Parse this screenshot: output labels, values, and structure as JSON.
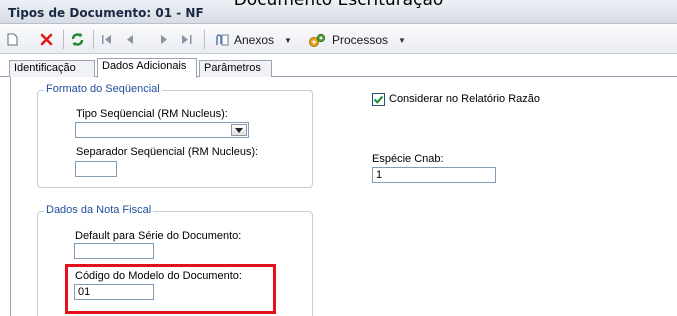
{
  "caption": "Documento Escrituração",
  "window": {
    "title": "Tipos de Documento: 01 - NF"
  },
  "toolbar": {
    "anexos_label": "Anexos",
    "processos_label": "Processos",
    "dropdown_arrow": "▼"
  },
  "tabs": [
    {
      "label": "Identificação",
      "active": false
    },
    {
      "label": "Dados Adicionais",
      "active": true
    },
    {
      "label": "Parâmetros",
      "active": false
    }
  ],
  "formato_sequencial": {
    "legend": "Formato do Seqüencial",
    "tipo_label": "Tipo Seqüencial (RM Nucleus):",
    "tipo_value": "",
    "separador_label": "Separador Seqüencial (RM Nucleus):",
    "separador_value": ""
  },
  "considerar_razao": {
    "label": "Considerar no Relatório Razão",
    "checked": true
  },
  "especie_cnab": {
    "label": "Espécie Cnab:",
    "value": "1"
  },
  "dados_nota_fiscal": {
    "legend": "Dados da Nota Fiscal",
    "serie_label": "Default para Série do Documento:",
    "serie_value": "",
    "modelo_label": "Código do Modelo do Documento:",
    "modelo_value": "01"
  },
  "colors": {
    "highlight": "#e3111b",
    "legend_text": "#1f4e9c",
    "check": "#1a8a2e"
  }
}
